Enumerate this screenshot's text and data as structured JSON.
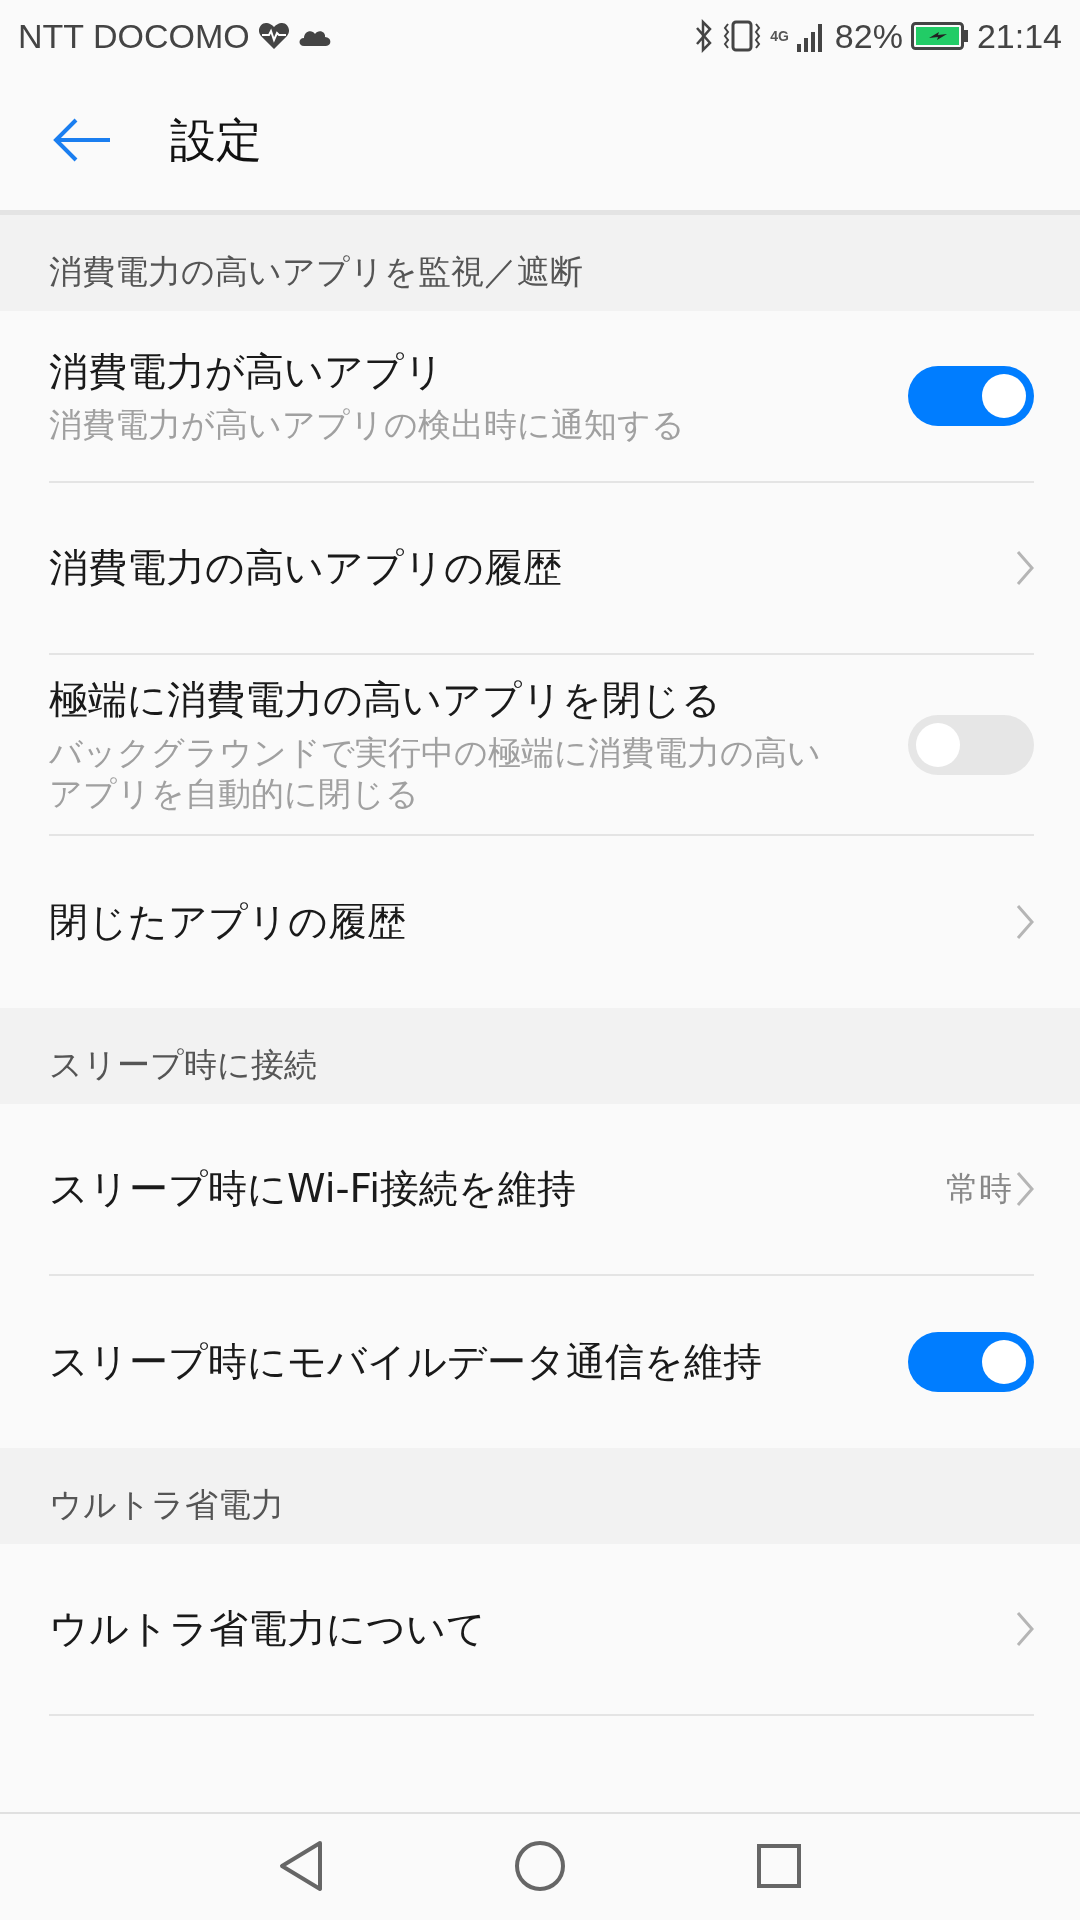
{
  "status_bar": {
    "carrier": "NTT DOCOMO",
    "network": "4G",
    "battery": "82%",
    "time": "21:14"
  },
  "header": {
    "title": "設定"
  },
  "sections": [
    {
      "title": "消費電力の高いアプリを監視／遮断",
      "rows": [
        {
          "kind": "toggle",
          "title": "消費電力が高いアプリ",
          "subtitle": "消費電力が高いアプリの検出時に通知する",
          "on": true
        },
        {
          "kind": "link",
          "title": "消費電力の高いアプリの履歴"
        },
        {
          "kind": "toggle",
          "title": "極端に消費電力の高いアプリを閉じる",
          "subtitle": "バックグラウンドで実行中の極端に消費電力の高いアプリを自動的に閉じる",
          "on": false
        },
        {
          "kind": "link",
          "title": "閉じたアプリの履歴"
        }
      ]
    },
    {
      "title": "スリープ時に接続",
      "rows": [
        {
          "kind": "link",
          "title": "スリープ時にWi-Fi接続を維持",
          "value": "常時"
        },
        {
          "kind": "toggle",
          "title": "スリープ時にモバイルデータ通信を維持",
          "on": true
        }
      ]
    },
    {
      "title": "ウルトラ省電力",
      "rows": [
        {
          "kind": "link",
          "title": "ウルトラ省電力について"
        }
      ]
    }
  ]
}
